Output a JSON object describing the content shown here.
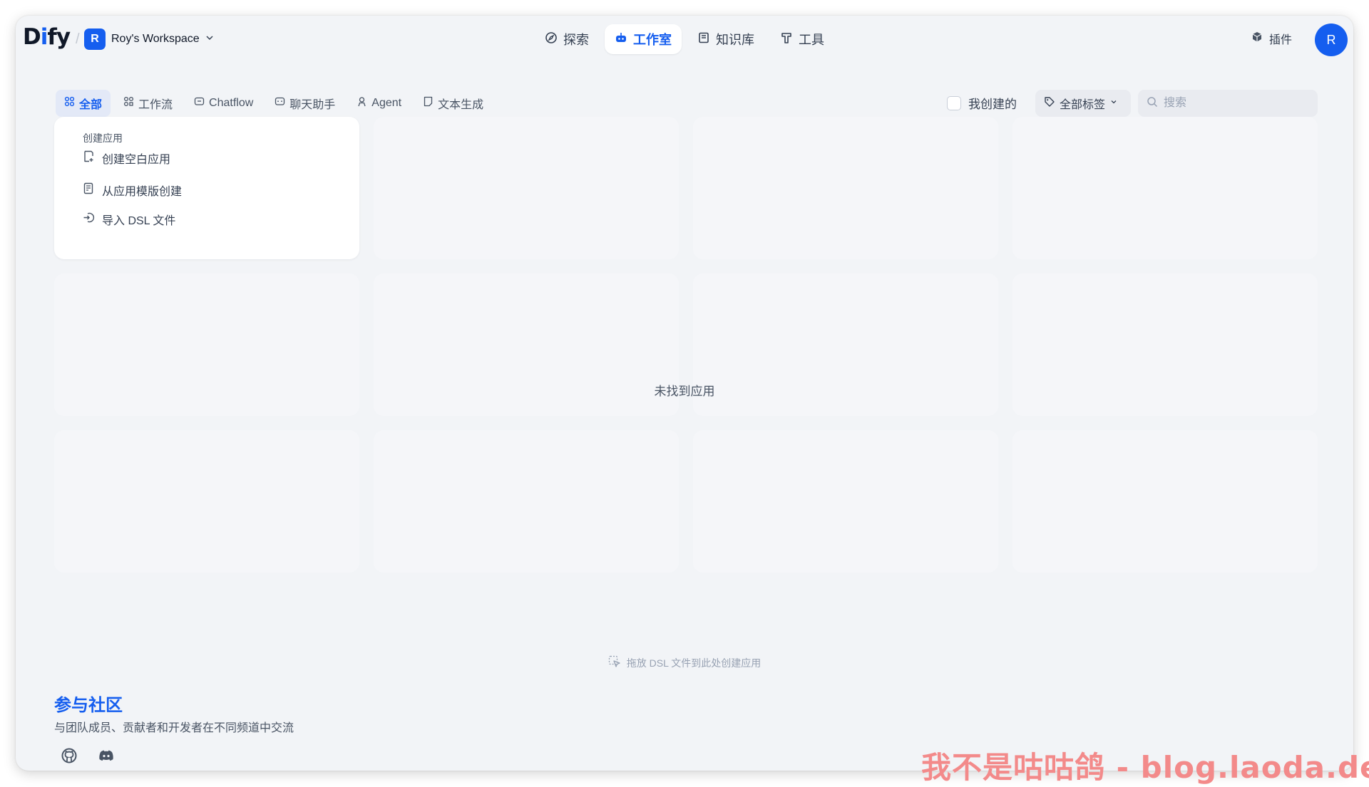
{
  "header": {
    "logo_text_a": "D",
    "logo_text_i": "i",
    "logo_text_b": "fy",
    "workspace_initial": "R",
    "workspace_name": "Roy's Workspace",
    "nav": [
      {
        "label": "探索",
        "icon": "compass-icon"
      },
      {
        "label": "工作室",
        "icon": "robot-icon"
      },
      {
        "label": "知识库",
        "icon": "book-icon"
      },
      {
        "label": "工具",
        "icon": "hammer-icon"
      }
    ],
    "plugin_label": "插件",
    "user_initial": "R"
  },
  "filters": {
    "tabs": [
      {
        "label": "全部",
        "icon": "grid-icon"
      },
      {
        "label": "工作流",
        "icon": "workflow-icon"
      },
      {
        "label": "Chatflow",
        "icon": "chatflow-icon"
      },
      {
        "label": "聊天助手",
        "icon": "chat-icon"
      },
      {
        "label": "Agent",
        "icon": "agent-icon"
      },
      {
        "label": "文本生成",
        "icon": "document-icon"
      }
    ],
    "mine_label": "我创建的",
    "tags_label": "全部标签",
    "search_placeholder": "搜索"
  },
  "create": {
    "title": "创建应用",
    "items": [
      {
        "label": "创建空白应用",
        "icon": "blank-file-icon"
      },
      {
        "label": "从应用模版创建",
        "icon": "template-icon"
      },
      {
        "label": "导入 DSL 文件",
        "icon": "import-icon"
      }
    ]
  },
  "main": {
    "empty_text": "未找到应用",
    "drop_hint": "拖放 DSL 文件到此处创建应用"
  },
  "community": {
    "title": "参与社区",
    "subtitle": "与团队成员、贡献者和开发者在不同频道中交流",
    "links": [
      {
        "icon": "github-icon"
      },
      {
        "icon": "discord-icon"
      }
    ]
  },
  "watermark": "我不是咕咕鸽 - blog.laoda.de",
  "colors": {
    "accent": "#155eef",
    "background": "#f2f4f7"
  }
}
